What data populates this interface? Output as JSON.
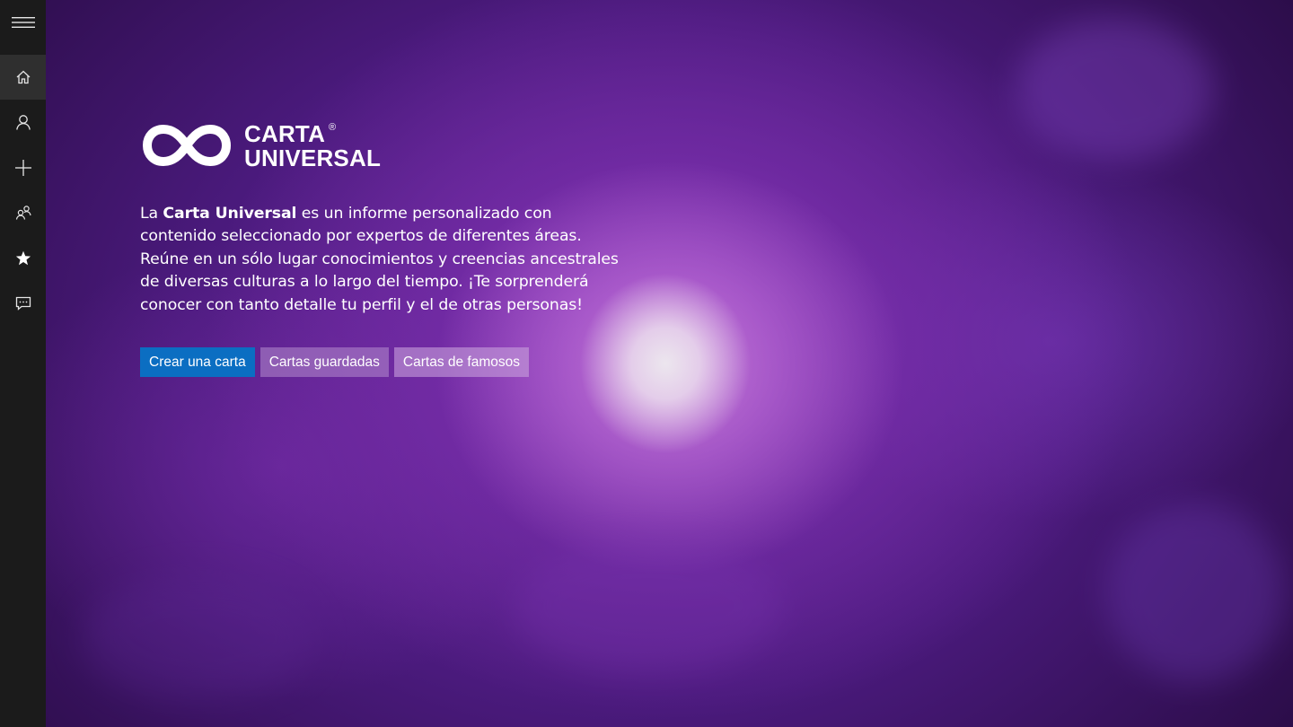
{
  "sidebar": {
    "items": [
      {
        "icon": "hamburger-menu-icon",
        "label": "Menu"
      },
      {
        "icon": "home-icon",
        "label": "Home",
        "active": true
      },
      {
        "icon": "person-icon",
        "label": "Profile"
      },
      {
        "icon": "plus-icon",
        "label": "New"
      },
      {
        "icon": "people-icon",
        "label": "People"
      },
      {
        "icon": "star-icon",
        "label": "Favorites"
      },
      {
        "icon": "chat-feedback-icon",
        "label": "Feedback"
      }
    ]
  },
  "logo": {
    "line1": "CARTA",
    "line2": "UNIVERSAL",
    "registered": "®"
  },
  "description": {
    "intro": "La ",
    "brand": "Carta Universal",
    "body": " es un informe personalizado con contenido seleccionado por expertos de diferentes áreas. Reúne en un sólo lugar conocimientos y creencias ancestrales de diversas culturas a lo largo del tiempo. ¡Te sorprenderá conocer con tanto detalle tu perfil y el de otras personas!"
  },
  "actions": {
    "create": "Crear una carta",
    "saved": "Cartas guardadas",
    "famous": "Cartas de famosos"
  },
  "colors": {
    "sidebar": "#1b1b1b",
    "sidebar_active": "#2f2f2f",
    "primary_button": "#0b6ec2",
    "background": "#4a1a7c"
  }
}
